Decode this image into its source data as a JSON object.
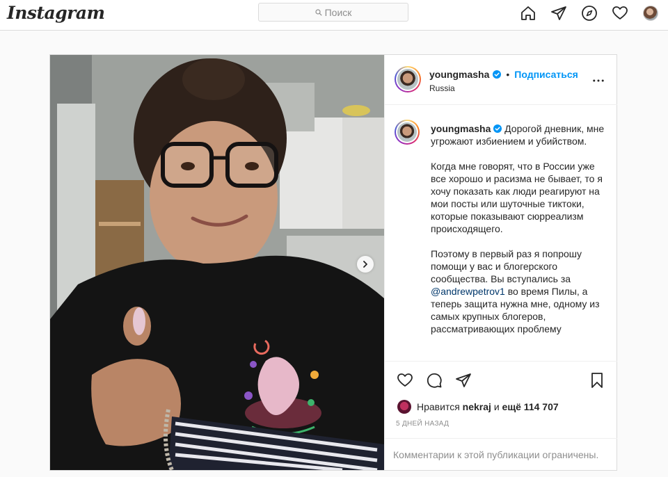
{
  "app": {
    "logo": "Instagram"
  },
  "search": {
    "placeholder": "Поиск"
  },
  "nav": {
    "icons": [
      "home-icon",
      "direct-icon",
      "explore-icon",
      "heart-icon",
      "profile-avatar"
    ]
  },
  "post": {
    "author": {
      "username": "youngmasha",
      "verified": true,
      "follow_label": "Подписаться",
      "location": "Russia"
    },
    "caption": {
      "username": "youngmasha",
      "text_part1": "Дорогой дневник, мне угрожают избиением и убийством.\n\nКогда мне говорят, что в России уже все хорошо и расизма не бывает, то я хочу показать как люди реагируют на мои посты или шуточные тиктоки, которые показывают сюрреализм происходящего.\n\nПоэтому в первый раз я попрошу помощи у вас и блогерского сообщества. Вы вступались за ",
      "mention": "@andrewpetrov1",
      "text_part2": " во время Пилы, а теперь защита нужна мне, одному из самых крупных блогеров, рассматривающих проблему"
    },
    "likes": {
      "prefix": "Нравится",
      "user": "nekraj",
      "middle": "и",
      "count": "ещё 114 707"
    },
    "time_ago": "5 ДНЕЙ НАЗАД",
    "comments_limited": "Комментарии к этой публикации ограничены."
  },
  "colors": {
    "accent": "#0095f6",
    "text": "#262626",
    "muted": "#8e8e8e",
    "border": "#dbdbdb"
  }
}
